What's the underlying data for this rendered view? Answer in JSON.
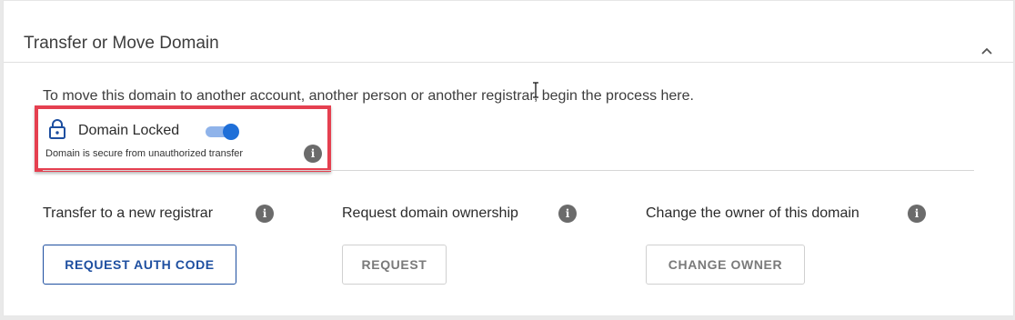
{
  "section": {
    "title": "Transfer or Move Domain",
    "collapse_icon": "chevron-up-icon",
    "description": "To move this domain to another account, another person or another registrar, begin the process here."
  },
  "domain_lock": {
    "label": "Domain Locked",
    "enabled": true,
    "subtext": "Domain is secure from unauthorized transfer",
    "lock_icon": "lock-icon",
    "info_icon": "info-icon",
    "highlight_color": "#e54050",
    "toggle_color": "#1f6fd8"
  },
  "options": [
    {
      "label": "Transfer to a new registrar",
      "button": "REQUEST AUTH CODE",
      "state": "enabled"
    },
    {
      "label": "Request domain ownership",
      "button": "REQUEST",
      "state": "disabled"
    },
    {
      "label": "Change the owner of this domain",
      "button": "CHANGE OWNER",
      "state": "disabled"
    }
  ],
  "colors": {
    "primary": "#1e4fa0",
    "text": "#3d3d3d",
    "info_icon_bg": "#6b6b6b"
  }
}
